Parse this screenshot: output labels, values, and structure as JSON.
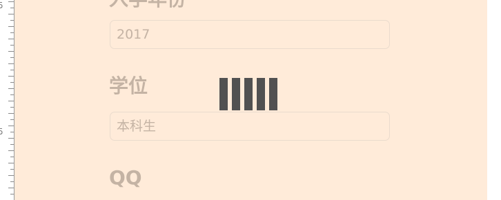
{
  "ruler": {
    "labels": [
      "5",
      "5"
    ]
  },
  "form": {
    "fields": [
      {
        "label": "入学年份",
        "value": "2017",
        "placeholder": ""
      },
      {
        "label": "学位",
        "value": "",
        "placeholder": "本科生"
      },
      {
        "label": "QQ"
      }
    ]
  },
  "loading": {
    "bar_count": 5,
    "color": "#515151"
  },
  "colors": {
    "panel_background": "#ffebd9",
    "text_muted": "#c4b3a4",
    "input_border": "#eadbcd"
  }
}
